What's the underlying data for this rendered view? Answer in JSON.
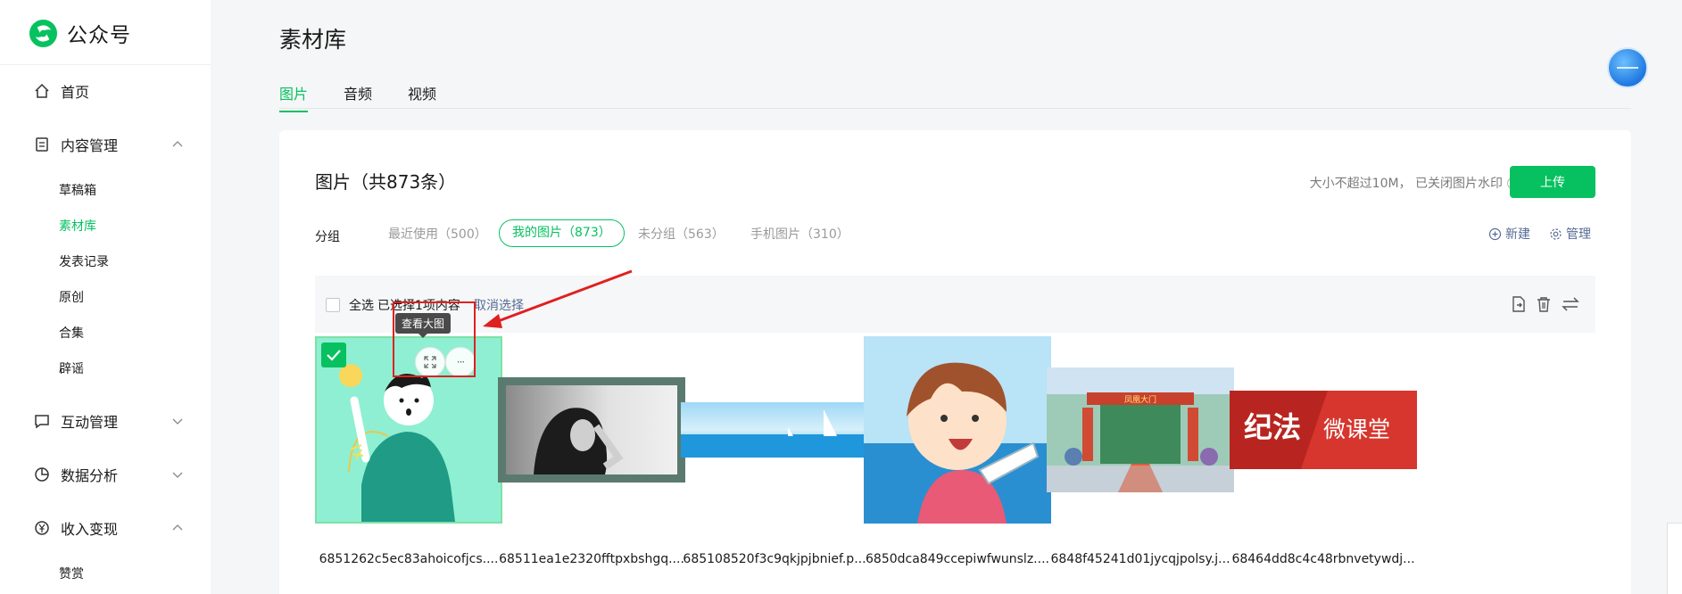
{
  "app": {
    "name": "公众号"
  },
  "sidebar": {
    "home": "首页",
    "content": "内容管理",
    "content_items": [
      "草稿箱",
      "素材库",
      "发表记录",
      "原创",
      "合集",
      "辟谣"
    ],
    "interaction": "互动管理",
    "analytics": "数据分析",
    "monetization": "收入变现",
    "monetization_items": [
      "赞赏"
    ]
  },
  "main": {
    "title": "素材库",
    "tabs": [
      "图片",
      "音频",
      "视频"
    ],
    "card_title": "图片（共873条）",
    "upload_hint": "大小不超过10M， 已关闭图片水印",
    "help_glyph": "?",
    "upload_label": "上传",
    "group_label": "分组",
    "groups": [
      "最近使用（500）",
      "我的图片（873）",
      "未分组（563）",
      "手机图片（310）"
    ],
    "new_label": "新建",
    "manage_label": "管理",
    "select_all": "全选",
    "selected_text": "已选择1项内容",
    "cancel_select": "取消选择",
    "tooltip": "查看大图",
    "more_glyph": "···",
    "files": [
      "6851262c5ec83ahoicofjcs....",
      "68511ea1e2320fftpxbshgq....",
      "685108520f3c9qkjpjbnief.p...",
      "6850dca849ccepiwfwunslz....",
      "6848f45241d01jycqjpolsy.j...",
      "68464dd8c4c48rbnvetywdj..."
    ],
    "banner_text_left": "纪法",
    "banner_text_right": "微课堂",
    "building_sign": "凤凰大门"
  },
  "colors": {
    "accent": "#07c160",
    "link": "#576b95",
    "annotation": "#e02020"
  }
}
